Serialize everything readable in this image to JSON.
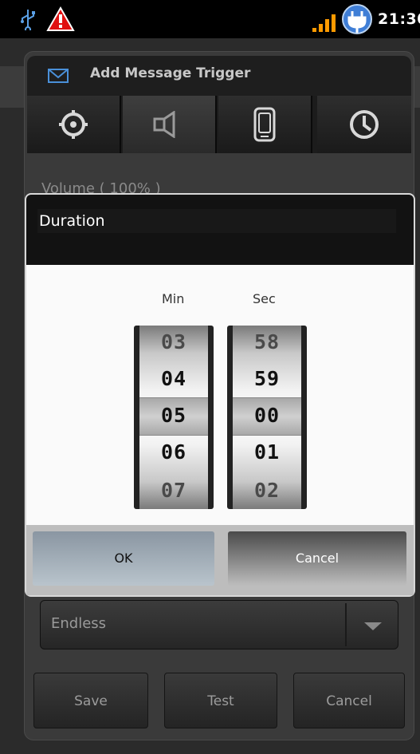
{
  "status_bar": {
    "time": "21:30",
    "icons": [
      "usb-icon",
      "warning-icon",
      "signal-icon",
      "battery-charging-icon"
    ]
  },
  "background": {
    "trigger_title": "Add Message Trigger",
    "tabs": [
      "gear-icon",
      "speaker-icon",
      "phone-icon",
      "clock-icon"
    ],
    "volume_label": "Volume ( 100% )",
    "repeat_select": "Endless",
    "buttons": {
      "save": "Save",
      "test": "Test",
      "cancel": "Cancel"
    }
  },
  "dialog": {
    "title": "Duration",
    "min_label": "Min",
    "sec_label": "Sec",
    "minutes": [
      "03",
      "04",
      "05",
      "06",
      "07"
    ],
    "seconds": [
      "58",
      "59",
      "00",
      "01",
      "02"
    ],
    "selected_minute": "05",
    "selected_second": "00",
    "ok_label": "OK",
    "cancel_label": "Cancel"
  },
  "colors": {
    "dialog_ok": "#9aa6b1",
    "background": "#2b2b2b"
  }
}
